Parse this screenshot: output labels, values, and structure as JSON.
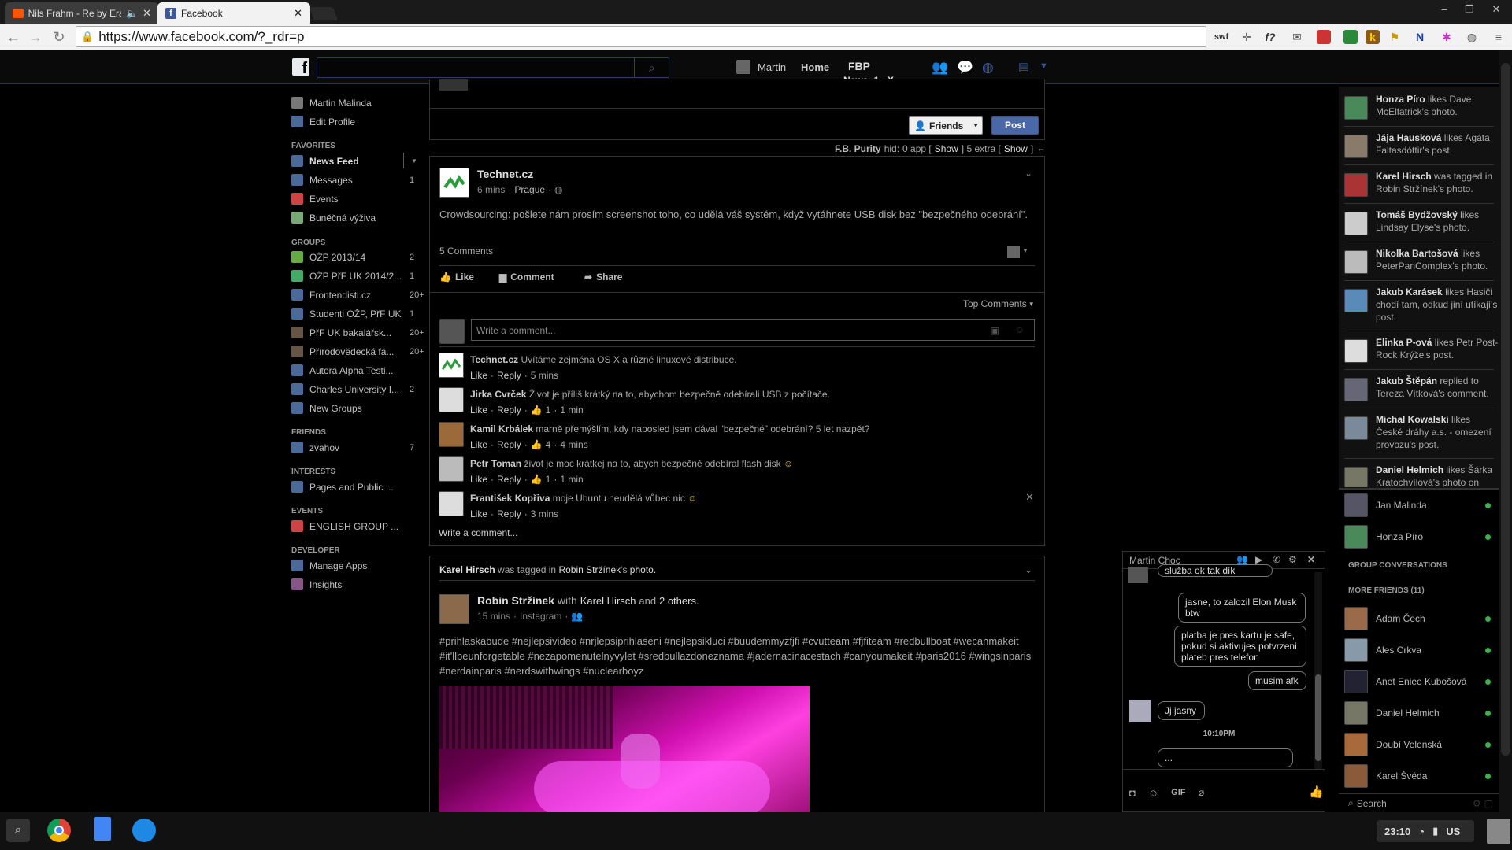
{
  "browser": {
    "tabs": [
      {
        "title": "Nils Frahm - Re by Eras",
        "icon": "soundcloud-icon"
      },
      {
        "title": "Facebook",
        "icon": "facebook-icon"
      }
    ],
    "url": "https://www.facebook.com/?_rdr=p",
    "ext_swf": "swf",
    "ext_fx": "f?"
  },
  "fb_header": {
    "user": "Martin",
    "home": "Home",
    "fbp": "FBP",
    "news": "News: 1",
    "news_close": "X"
  },
  "left_nav": {
    "profile": "Martin Malinda",
    "edit_profile": "Edit Profile",
    "favorites_title": "FAVORITES",
    "favorites": [
      {
        "label": "News Feed",
        "count": ""
      },
      {
        "label": "Messages",
        "count": "1"
      },
      {
        "label": "Events",
        "count": ""
      },
      {
        "label": "Buněčná výživa",
        "count": ""
      }
    ],
    "groups_title": "GROUPS",
    "groups": [
      {
        "label": "OŽP 2013/14",
        "count": "2"
      },
      {
        "label": "OŽP PřF UK 2014/2...",
        "count": "1"
      },
      {
        "label": "Frontendisti.cz",
        "count": "20+"
      },
      {
        "label": "Studenti OŽP, PřF UK",
        "count": "1"
      },
      {
        "label": "PřF UK bakalářsk...",
        "count": "20+"
      },
      {
        "label": "Přírodovědecká fa...",
        "count": "20+"
      },
      {
        "label": "Autora Alpha Testi...",
        "count": ""
      },
      {
        "label": "Charles University I...",
        "count": "2"
      },
      {
        "label": "New Groups",
        "count": ""
      }
    ],
    "friends_title": "FRIENDS",
    "friends": [
      {
        "label": "zvahov",
        "count": "7"
      }
    ],
    "interests_title": "INTERESTS",
    "interests": [
      {
        "label": "Pages and Public ..."
      }
    ],
    "events_title": "EVENTS",
    "events": [
      {
        "label": "ENGLISH GROUP ..."
      }
    ],
    "developer_title": "DEVELOPER",
    "developer": [
      {
        "label": "Manage Apps"
      },
      {
        "label": "Insights"
      }
    ]
  },
  "composer": {
    "audience": "Friends",
    "post": "Post"
  },
  "fbpurity": {
    "name": "F.B. Purity",
    "hid": "hid:",
    "app": "0 app [",
    "show1": "Show",
    "extra": "] 5 extra [",
    "show2": "Show",
    "end": "]"
  },
  "post1": {
    "author": "Technet.cz",
    "time": "6 mins",
    "place": "Prague",
    "text": "Crowdsourcing: pošlete nám prosím screenshot toho, co udělá váš systém, když vytáhnete USB disk bez \"bezpečného odebrání\".",
    "comments_count": "5 Comments",
    "like": "Like",
    "comment": "Comment",
    "share": "Share",
    "top_comments": "Top Comments",
    "write_placeholder": "Write a comment...",
    "comments": [
      {
        "author": "Technet.cz",
        "text": "Uvítáme zejména OS X a různé linuxové distribuce.",
        "likes": "",
        "time": "5 mins"
      },
      {
        "author": "Jirka Cvrček",
        "text": "Život je příliš krátký na to, abychom bezpečně odebírali USB z počítače.",
        "likes": "1",
        "time": "1 min"
      },
      {
        "author": "Kamil Krbálek",
        "text": "marně přemýšlím, kdy naposled jsem dával \"bezpečné\" odebrání? 5 let nazpět?",
        "likes": "4",
        "time": "4 mins"
      },
      {
        "author": "Petr Toman",
        "text": "život je moc krátkej na to, abych bezpečně odebíral flash disk",
        "likes": "1",
        "time": "1 min"
      },
      {
        "author": "František Kopřiva",
        "text": "moje Ubuntu neudělá vůbec nic",
        "likes": "",
        "time": "3 mins"
      }
    ],
    "like_label": "Like",
    "reply_label": "Reply",
    "write_comment": "Write a comment..."
  },
  "post2": {
    "story_actor": "Karel Hirsch",
    "story_mid": "was tagged in",
    "story_target": "Robin Stržínek",
    "story_suffix": "'s",
    "story_photo": "photo.",
    "author": "Robin Stržínek",
    "with": "with",
    "tagged": "Karel Hirsch",
    "and": "and",
    "others": "2 others.",
    "time": "15 mins",
    "via": "Instagram",
    "text": "#prihlaskabude #nejlepsivideo #nrjlepsiprihlaseni #nejlepsikluci #buudemmyzfjfi #cvutteam #fjfiteam #redbullboat #wecanmakeit #it'llbeunforgetable #nezapomenutelnyvylet #sredbullazdoneznama #jadernacinacestach #canyoumakeit #paris2016 #wingsinparis #nerdainparis #nerdswithwings #nuclearboyz"
  },
  "ticker": [
    {
      "name": "Honza Píro",
      "action": "likes Dave McElfatrick's photo."
    },
    {
      "name": "Jája Hausková",
      "action": "likes Agáta Faltasdóttir's post."
    },
    {
      "name": "Karel Hirsch",
      "action": "was tagged in Robin Stržínek's photo."
    },
    {
      "name": "Tomáš Bydžovský",
      "action": "likes Lindsay Elyse's photo."
    },
    {
      "name": "Nikolka Bartošová",
      "action": "likes PeterPanComplex's photo."
    },
    {
      "name": "Jakub Karásek",
      "action": "likes Hasiči chodí tam, odkud jiní utíkají's post."
    },
    {
      "name": "Elinka P-ová",
      "action": "likes Petr Post-Rock Krýže's post."
    },
    {
      "name": "Jakub Štěpán",
      "action": "replied to Tereza Vítková's comment."
    },
    {
      "name": "Michal Kowalski",
      "action": "likes České dráhy a.s. - omezení provozu's post."
    },
    {
      "name": "Daniel Helmich",
      "action": "likes Šárka Kratochvílová's photo on"
    }
  ],
  "online_friends": [
    {
      "name": "Jan Malinda"
    },
    {
      "name": "Honza Píro"
    }
  ],
  "group_conversations": "GROUP CONVERSATIONS",
  "more_friends": "MORE FRIENDS (11)",
  "more_friends_list": [
    {
      "name": "Adam Čech"
    },
    {
      "name": "Ales Crkva"
    },
    {
      "name": "Anet Eniee Kubošová"
    },
    {
      "name": "Daniel Helmich"
    },
    {
      "name": "Doubí Velenská"
    },
    {
      "name": "Karel Švéda"
    }
  ],
  "sidebar_search": "Search",
  "chat": {
    "title": "Martin Choc",
    "messages": [
      {
        "text": "služba ok tak dík",
        "side": "right"
      },
      {
        "text": "jasne, to zalozil Elon Musk btw",
        "side": "right"
      },
      {
        "text": "platba je pres kartu je safe, pokud si aktivujes potvrzeni plateb pres telefon",
        "side": "right"
      },
      {
        "text": "musim afk",
        "side": "right"
      },
      {
        "text": "Jj jasny",
        "side": "left"
      }
    ],
    "timestamp": "10:10PM",
    "typing": "...",
    "gif": "GIF"
  },
  "taskbar": {
    "time": "23:10",
    "locale": "US"
  },
  "colors": {
    "fb_blue": "#3b5998",
    "online": "#3cb24a",
    "bg": "#000000"
  }
}
